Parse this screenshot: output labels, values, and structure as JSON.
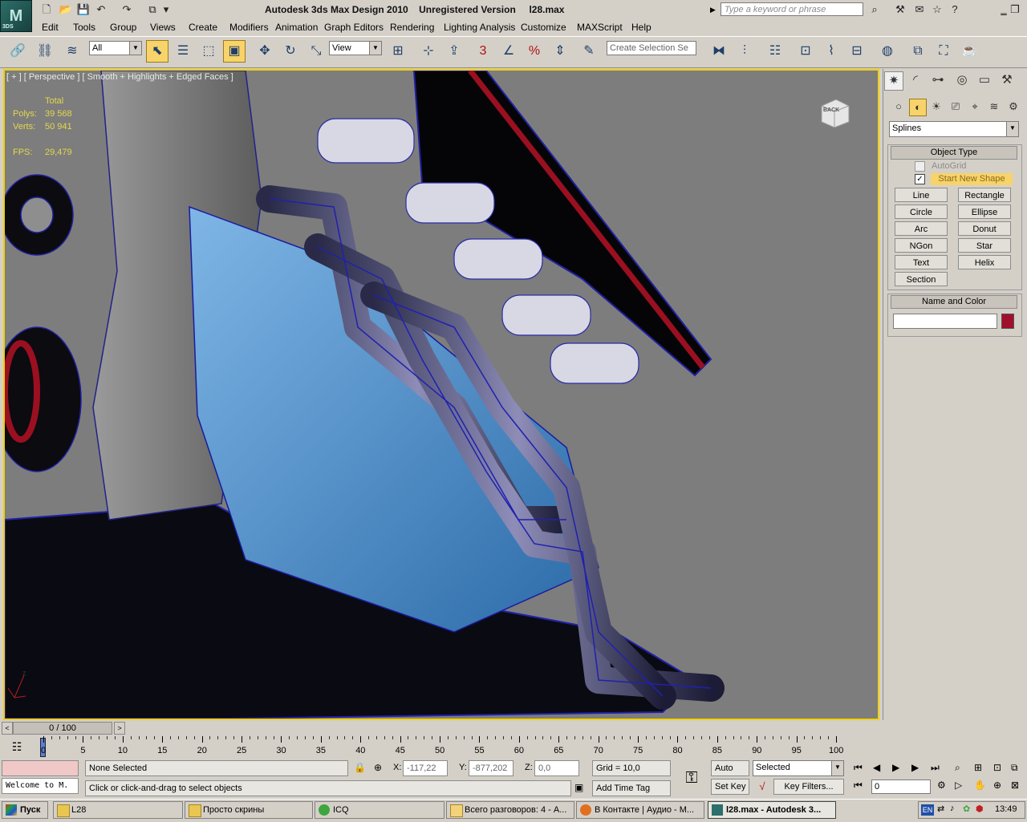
{
  "window": {
    "title": "Autodesk 3ds Max Design 2010    Unregistered Version     l28.max",
    "logo_sub": "3DS",
    "search_placeholder": "Type a keyword or phrase"
  },
  "menu": [
    "Edit",
    "Tools",
    "Group",
    "Views",
    "Create",
    "Modifiers",
    "Animation",
    "Graph Editors",
    "Rendering",
    "Lighting Analysis",
    "Customize",
    "MAXScript",
    "Help"
  ],
  "toolbar": {
    "selection_filter": "All",
    "ref_coord": "View",
    "named_selection_placeholder": "Create Selection Se",
    "snap_labels": {
      "snap": "3",
      "percent": "%"
    }
  },
  "viewport": {
    "label": "[ + ] [ Perspective ] [ Smooth + Highlights + Edged Faces ]",
    "stats": {
      "header": "Total",
      "polys_label": "Polys:",
      "polys_value": "39 568",
      "verts_label": "Verts:",
      "verts_value": "50 941",
      "fps_label": "FPS:",
      "fps_value": "29,479"
    },
    "viewcube_label": "BACK",
    "axis_label": "z"
  },
  "command_panel": {
    "dropdown": "Splines",
    "object_type_title": "Object Type",
    "autogrid": "AutoGrid",
    "start_new_shape": "Start New Shape",
    "buttons": [
      "Line",
      "Rectangle",
      "Circle",
      "Ellipse",
      "Arc",
      "Donut",
      "NGon",
      "Star",
      "Text",
      "Helix",
      "Section"
    ],
    "name_color_title": "Name and Color",
    "name_value": "",
    "swatch_color": "#a0102a"
  },
  "timeline": {
    "slider_label": "0 / 100",
    "ticks": [
      "0",
      "5",
      "10",
      "15",
      "20",
      "25",
      "30",
      "35",
      "40",
      "45",
      "50",
      "55",
      "60",
      "65",
      "70",
      "75",
      "80",
      "85",
      "90",
      "95",
      "100"
    ]
  },
  "statusbar": {
    "maxscript_listener": "Welcome to M.",
    "selection_status": "None Selected",
    "prompt": "Click or click-and-drag to select objects",
    "x_label": "X:",
    "x_value": "-117,22",
    "y_label": "Y:",
    "y_value": "-877,202",
    "z_label": "Z:",
    "z_value": "0,0",
    "grid": "Grid = 10,0",
    "add_time_tag": "Add Time Tag",
    "auto_key": "Auto Key",
    "set_key": "Set Key",
    "key_mode": "Selected",
    "key_filters": "Key Filters...",
    "frame_value": "0"
  },
  "taskbar": {
    "start": "Пуск",
    "tasks": [
      "L28",
      "Просто скрины",
      "ICQ",
      "Всего разговоров: 4 - А...",
      "В Контакте | Аудио - М...",
      "l28.max - Autodesk 3..."
    ],
    "lang": "EN",
    "clock": "13:49"
  }
}
